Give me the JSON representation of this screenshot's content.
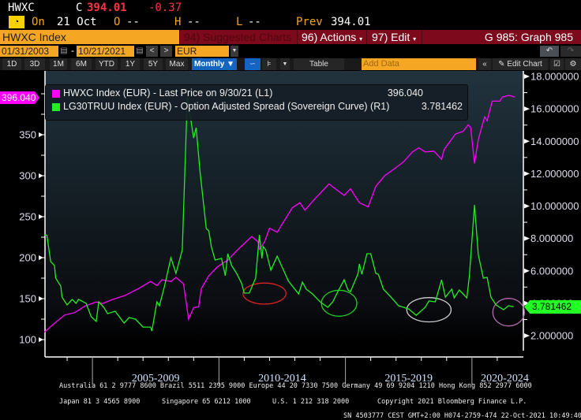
{
  "quote": {
    "ticker": "HWXC",
    "close_label": "C",
    "close": "394.01",
    "change": "-0.37",
    "on_label": "On",
    "date": "21 Oct",
    "open_label": "O",
    "open": "--",
    "high_label": "H",
    "high": "--",
    "low_label": "L",
    "low": "--",
    "prev_label": "Prev",
    "prev": "394.01"
  },
  "titlebar": {
    "security": "HWXC Index",
    "suggested": "94) Suggested Charts",
    "actions": "96) Actions",
    "edit": "97) Edit",
    "graph": "G 985: Graph 985"
  },
  "range": {
    "start": "01/31/2003",
    "sep": "-",
    "end": "10/21/2021",
    "currency": "EUR"
  },
  "toolbar": {
    "periods": [
      "1D",
      "3D",
      "1M",
      "6M",
      "YTD",
      "1Y",
      "5Y",
      "Max"
    ],
    "frequency": "Monthly",
    "table": "Table",
    "add_data_placeholder": "Add Data",
    "edit_chart": "Edit Chart"
  },
  "colors": {
    "series1": "#ff00ff",
    "series2": "#22ee22",
    "accent": "#f5a623",
    "titlebar": "#7d0a1c"
  },
  "chart_data": {
    "type": "line",
    "legend": [
      {
        "label": "HWXC Index (EUR) - Last Price on 9/30/21 (L1)",
        "value": "396.040"
      },
      {
        "label": "LG30TRUU Index (EUR) - Option Adjusted Spread (Sovereign Curve) (R1)",
        "value": "3.781462"
      }
    ],
    "legend_placement": "top-left",
    "last_labels": {
      "left": "396.040",
      "right": "3.781462"
    },
    "left_axis": {
      "ticks": [
        "100",
        "150",
        "200",
        "250",
        "300",
        "350"
      ],
      "range": [
        95,
        410
      ]
    },
    "right_axis": {
      "ticks": [
        "2.000000",
        "4.000000",
        "6.000000",
        "8.000000",
        "10.000000",
        "12.000000",
        "14.000000",
        "16.000000",
        "18.000000"
      ],
      "range": [
        1.5,
        18.5
      ]
    },
    "x_axis": {
      "range": [
        2003.0,
        2022.0
      ],
      "period_labels": [
        {
          "label": "2005-2009",
          "center": 2007.5
        },
        {
          "label": "2010-2014",
          "center": 2012.5
        },
        {
          "label": "2015-2019",
          "center": 2017.5
        },
        {
          "label": "2020-2024",
          "center": 2021.3
        }
      ]
    },
    "series": [
      {
        "name": "HWXC Index (EUR)",
        "axis": "left",
        "points": [
          [
            2003.1,
            109
          ],
          [
            2003.5,
            120
          ],
          [
            2003.9,
            130
          ],
          [
            2004.3,
            133
          ],
          [
            2004.7,
            141
          ],
          [
            2005.15,
            146
          ],
          [
            2005.4,
            144
          ],
          [
            2005.8,
            149
          ],
          [
            2006.3,
            154
          ],
          [
            2006.8,
            162
          ],
          [
            2007.3,
            171
          ],
          [
            2007.55,
            166
          ],
          [
            2007.75,
            173
          ],
          [
            2008.1,
            171
          ],
          [
            2008.3,
            176
          ],
          [
            2008.6,
            168
          ],
          [
            2008.8,
            125
          ],
          [
            2009.0,
            139
          ],
          [
            2009.2,
            140
          ],
          [
            2009.3,
            162
          ],
          [
            2009.6,
            178
          ],
          [
            2009.95,
            189
          ],
          [
            2010.35,
            197
          ],
          [
            2010.75,
            210
          ],
          [
            2011.3,
            226
          ],
          [
            2011.55,
            219
          ],
          [
            2011.6,
            210
          ],
          [
            2011.8,
            219
          ],
          [
            2012.0,
            236
          ],
          [
            2012.3,
            231
          ],
          [
            2012.9,
            261
          ],
          [
            2013.2,
            267
          ],
          [
            2013.4,
            258
          ],
          [
            2013.8,
            272
          ],
          [
            2014.35,
            290
          ],
          [
            2014.6,
            284
          ],
          [
            2014.95,
            276
          ],
          [
            2015.2,
            284
          ],
          [
            2015.55,
            267
          ],
          [
            2015.9,
            262
          ],
          [
            2016.2,
            287
          ],
          [
            2016.55,
            300
          ],
          [
            2017.0,
            310
          ],
          [
            2017.3,
            317
          ],
          [
            2017.65,
            329
          ],
          [
            2017.9,
            334
          ],
          [
            2018.15,
            329
          ],
          [
            2018.5,
            330
          ],
          [
            2018.8,
            320
          ],
          [
            2018.9,
            332
          ],
          [
            2019.35,
            351
          ],
          [
            2019.65,
            354
          ],
          [
            2019.85,
            362
          ],
          [
            2019.95,
            359
          ],
          [
            2020.1,
            315
          ],
          [
            2020.25,
            344
          ],
          [
            2020.5,
            372
          ],
          [
            2020.6,
            367
          ],
          [
            2020.8,
            391
          ],
          [
            2021.1,
            391
          ],
          [
            2021.2,
            396
          ],
          [
            2021.45,
            398
          ],
          [
            2021.6,
            397
          ],
          [
            2021.7,
            396
          ]
        ]
      },
      {
        "name": "LG30TRUU Index (EUR) OAS",
        "axis": "right",
        "points": [
          [
            2003.1,
            8.22
          ],
          [
            2003.2,
            8.2
          ],
          [
            2003.35,
            6.57
          ],
          [
            2003.5,
            6.33
          ],
          [
            2003.55,
            5.55
          ],
          [
            2003.75,
            5.06
          ],
          [
            2003.8,
            4.38
          ],
          [
            2004.0,
            3.9
          ],
          [
            2004.2,
            4.24
          ],
          [
            2004.35,
            4.0
          ],
          [
            2004.45,
            4.24
          ],
          [
            2004.75,
            4.0
          ],
          [
            2004.95,
            3.17
          ],
          [
            2005.15,
            2.88
          ],
          [
            2005.25,
            4.09
          ],
          [
            2005.45,
            3.75
          ],
          [
            2005.6,
            3.36
          ],
          [
            2005.9,
            3.51
          ],
          [
            2006.25,
            2.78
          ],
          [
            2006.45,
            3.12
          ],
          [
            2006.7,
            3.02
          ],
          [
            2007.0,
            2.53
          ],
          [
            2007.3,
            2.53
          ],
          [
            2007.35,
            2.29
          ],
          [
            2007.55,
            4.09
          ],
          [
            2007.65,
            3.85
          ],
          [
            2007.85,
            5.06
          ],
          [
            2008.1,
            6.81
          ],
          [
            2008.3,
            5.84
          ],
          [
            2008.55,
            7.3
          ],
          [
            2008.75,
            16.73
          ],
          [
            2009.0,
            14.2
          ],
          [
            2009.1,
            14.84
          ],
          [
            2009.25,
            12.16
          ],
          [
            2009.5,
            8.61
          ],
          [
            2009.6,
            8.47
          ],
          [
            2009.7,
            7.5
          ],
          [
            2009.85,
            6.67
          ],
          [
            2010.1,
            6.77
          ],
          [
            2010.25,
            5.7
          ],
          [
            2010.35,
            7.06
          ],
          [
            2010.5,
            6.33
          ],
          [
            2010.7,
            5.84
          ],
          [
            2010.9,
            5.21
          ],
          [
            2011.0,
            4.63
          ],
          [
            2011.2,
            4.63
          ],
          [
            2011.45,
            5.55
          ],
          [
            2011.6,
            8.22
          ],
          [
            2011.7,
            6.77
          ],
          [
            2011.75,
            7.5
          ],
          [
            2011.85,
            7.3
          ],
          [
            2012.05,
            6.04
          ],
          [
            2012.3,
            6.91
          ],
          [
            2012.75,
            5.36
          ],
          [
            2013.15,
            4.58
          ],
          [
            2013.3,
            5.31
          ],
          [
            2013.45,
            4.87
          ],
          [
            2013.7,
            4.58
          ],
          [
            2014.0,
            4.09
          ],
          [
            2014.3,
            3.75
          ],
          [
            2014.5,
            4.09
          ],
          [
            2014.7,
            4.72
          ],
          [
            2014.95,
            5.45
          ],
          [
            2015.1,
            4.82
          ],
          [
            2015.2,
            4.72
          ],
          [
            2015.5,
            5.84
          ],
          [
            2015.55,
            6.43
          ],
          [
            2015.65,
            5.79
          ],
          [
            2015.85,
            7.06
          ],
          [
            2016.0,
            7.06
          ],
          [
            2016.2,
            5.84
          ],
          [
            2016.3,
            5.79
          ],
          [
            2016.5,
            4.87
          ],
          [
            2016.8,
            4.38
          ],
          [
            2017.1,
            3.85
          ],
          [
            2017.5,
            3.65
          ],
          [
            2017.8,
            3.26
          ],
          [
            2018.15,
            3.75
          ],
          [
            2018.3,
            4.14
          ],
          [
            2018.55,
            4.09
          ],
          [
            2018.8,
            5.45
          ],
          [
            2018.95,
            4.38
          ],
          [
            2019.2,
            4.87
          ],
          [
            2019.3,
            4.33
          ],
          [
            2019.5,
            4.82
          ],
          [
            2019.8,
            4.33
          ],
          [
            2019.9,
            5.7
          ],
          [
            2020.1,
            10.07
          ],
          [
            2020.25,
            7.0
          ],
          [
            2020.45,
            5.55
          ],
          [
            2020.6,
            5.6
          ],
          [
            2020.75,
            4.38
          ],
          [
            2020.95,
            3.9
          ],
          [
            2021.25,
            3.6
          ],
          [
            2021.45,
            3.85
          ],
          [
            2021.65,
            3.78
          ]
        ]
      }
    ],
    "annotations": [
      {
        "type": "ellipse",
        "color": "#dd2222",
        "x": 2011.8,
        "y_right": 4.6,
        "span_years": 1.7,
        "span_value": 1.3
      },
      {
        "type": "ellipse",
        "color": "#22cc22",
        "x": 2014.75,
        "y_right": 4.0,
        "span_years": 1.4,
        "span_value": 1.6
      },
      {
        "type": "ellipse",
        "color": "#cccccc",
        "x": 2018.3,
        "y_right": 3.6,
        "span_years": 1.75,
        "span_value": 1.5
      },
      {
        "type": "ellipse",
        "color": "#b06aa8",
        "x": 2021.45,
        "y_right": 3.45,
        "span_years": 1.25,
        "span_value": 1.7
      }
    ]
  },
  "footer": {
    "line1": "Australia 61 2 9777 8600 Brazil 5511 2395 9000 Europe 44 20 7330 7500 Germany 49 69 9204 1210 Hong Kong 852 2977 6000",
    "line2_japan": "Japan 81 3 4565 8900",
    "line2_singapore": "Singapore 65 6212 1000",
    "line2_us": "U.S. 1 212 318 2000",
    "line2_copyright": "Copyright 2021 Bloomberg Finance L.P.",
    "line3": "SN 4503777 CEST GMT+2:00 H074-2759-474 22-Oct-2021 10:49:40"
  }
}
